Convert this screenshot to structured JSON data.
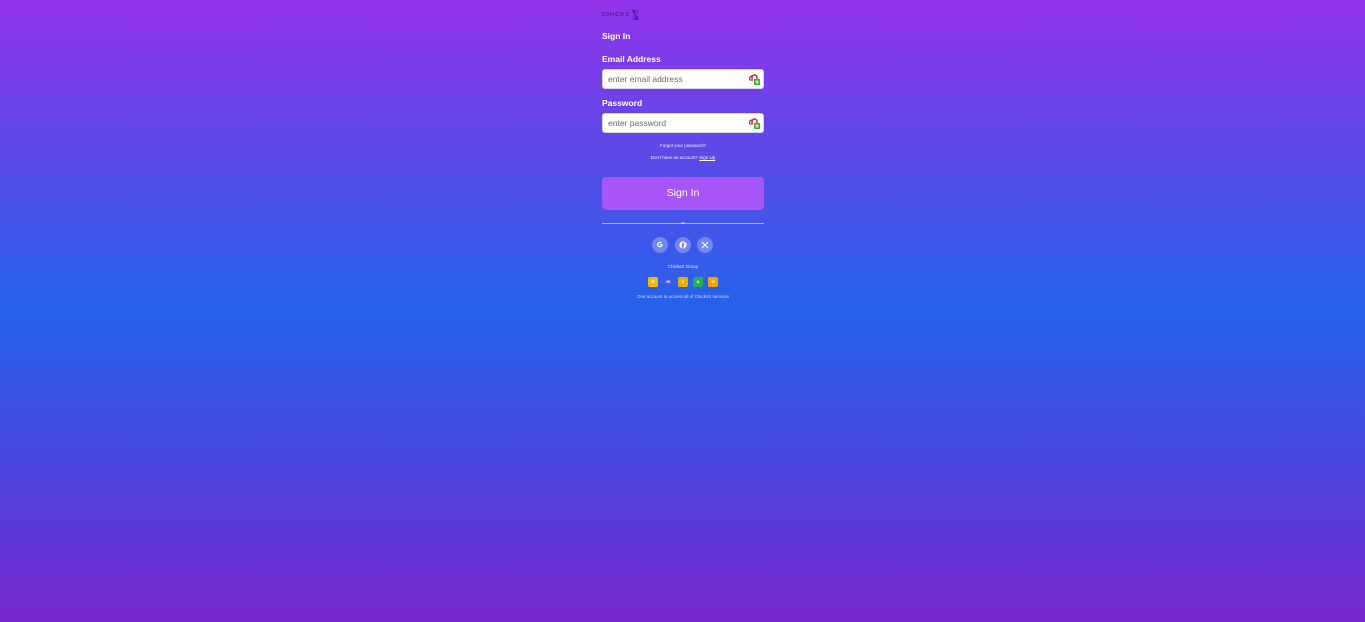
{
  "brand": {
    "logo_text": "CHICKS",
    "logo_mark": "X"
  },
  "form": {
    "title": "Sign In",
    "email": {
      "label": "Email Address",
      "value": "",
      "placeholder": "enter email address"
    },
    "password": {
      "label": "Password",
      "value": "",
      "placeholder": "enter password"
    },
    "forgot_link": "Forgot your password?",
    "no_account_text": "Don't have an account?",
    "signup_link": "Sign Up",
    "submit_label": "Sign In",
    "divider_text": "or"
  },
  "social_buttons": [
    {
      "name": "google",
      "icon": "google-icon"
    },
    {
      "name": "facebook",
      "icon": "facebook-icon"
    },
    {
      "name": "x",
      "icon": "x-icon"
    }
  ],
  "group": {
    "title": "ChicksX Group",
    "apps": [
      {
        "label": "M",
        "color": "#f5b800"
      },
      {
        "label": "JK",
        "color": "#3b59e6"
      },
      {
        "label": "$",
        "color": "#e8b000"
      },
      {
        "label": "A",
        "color": "#22b14c"
      },
      {
        "label": "M",
        "color": "#f0a500"
      }
    ],
    "footer": "One account to access all of ChicksX services"
  },
  "colors": {
    "gradient_top": "#9333ea",
    "gradient_mid": "#2563eb",
    "gradient_bottom": "#7a28d2",
    "button": "#a855f7"
  }
}
